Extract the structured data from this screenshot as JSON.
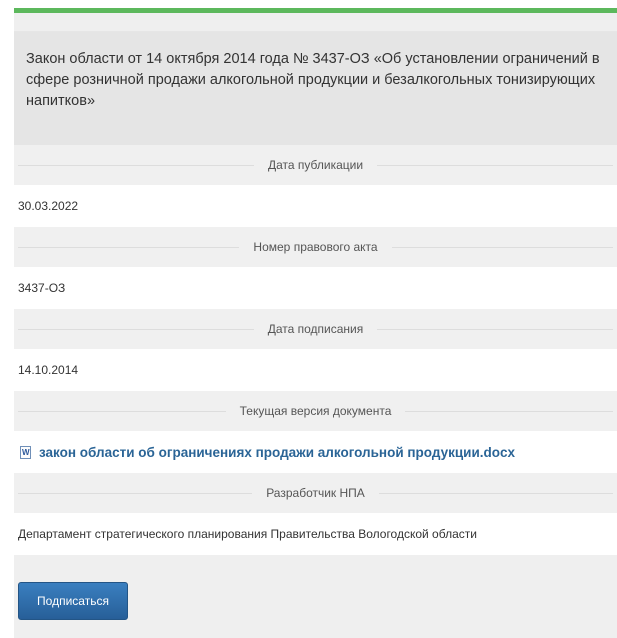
{
  "document": {
    "title": "Закон области от 14 октября 2014 года № 3437-ОЗ «Об установлении ограничений в сфере розничной продажи алкогольной продукции и безалкогольных тонизирующих напитков»"
  },
  "fields": {
    "publication_date": {
      "label": "Дата публикации",
      "value": "30.03.2022"
    },
    "act_number": {
      "label": "Номер правового акта",
      "value": "3437-ОЗ"
    },
    "signing_date": {
      "label": "Дата подписания",
      "value": "14.10.2014"
    },
    "current_version": {
      "label": "Текущая версия документа",
      "file_name": "закон области об ограничениях продажи алкогольной продукции.docx",
      "icon": "word-doc-icon"
    },
    "developer": {
      "label": "Разработчик НПА",
      "value": "Департамент стратегического планирования Правительства Вологодской области"
    }
  },
  "actions": {
    "subscribe_label": "Подписаться"
  },
  "colors": {
    "accent_bar": "#5cb85c",
    "link": "#2a6496",
    "button": "#2f6fad"
  }
}
